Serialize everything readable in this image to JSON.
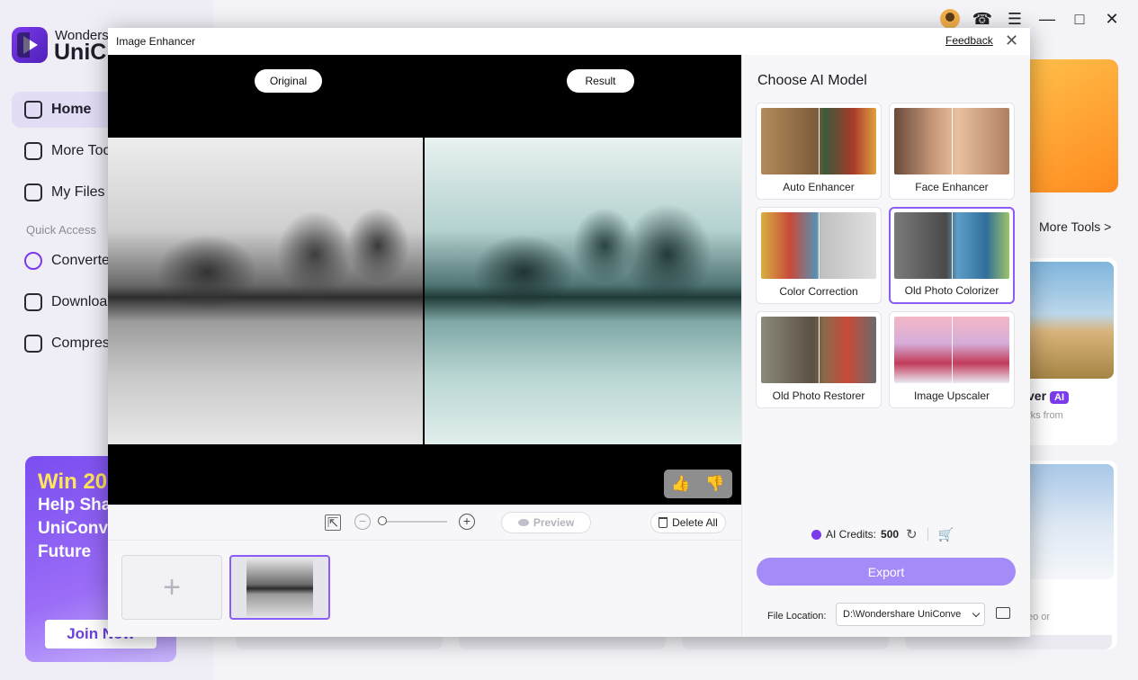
{
  "background": {
    "brand_line1": "Wonders",
    "brand_line2": "UniC",
    "nav": [
      "Home",
      "More Too",
      "My Files"
    ],
    "quick_access": "Quick Access",
    "quick_items": [
      "Converte",
      "Downloa",
      "Compres"
    ],
    "promo_line1": "Win 20",
    "promo_line2": "Help Sha",
    "promo_line3": "UniConv",
    "promo_line4": "Future",
    "promo_button": "Join Now",
    "more_tools": "More Tools  >",
    "ai_card_label": "ver",
    "ai_badge": "AI",
    "ai_card_sub": "rks from",
    "snow_card_sub": "eo or",
    "snow_card_dots": "...",
    "window_controls": [
      "avatar-icon",
      "headset-icon",
      "menu-icon",
      "minimize-icon",
      "maximize-icon",
      "close-icon"
    ]
  },
  "dialog": {
    "title": "Image Enhancer",
    "feedback": "Feedback",
    "close_icon": "close-icon",
    "preview": {
      "original_label": "Original",
      "result_label": "Result"
    },
    "toolbar": {
      "preview_label": "Preview",
      "delete_all_label": "Delete All"
    },
    "strip": {
      "add_glyph": "+"
    },
    "panel": {
      "title": "Choose AI Model",
      "models": [
        {
          "label": "Auto Enhancer",
          "selected": false
        },
        {
          "label": "Face Enhancer",
          "selected": false
        },
        {
          "label": "Color Correction",
          "selected": false
        },
        {
          "label": "Old Photo Colorizer",
          "selected": true
        },
        {
          "label": "Old Photo Restorer",
          "selected": false
        },
        {
          "label": "Image Upscaler",
          "selected": false
        }
      ],
      "credits_label": "AI Credits:",
      "credits_value": "500",
      "export_label": "Export",
      "file_location_label": "File Location:",
      "file_location_value": "D:\\Wondershare UniConve"
    }
  },
  "colors": {
    "accent": "#8b5cf6",
    "export_button": "#a58bf7",
    "brand_purple": "#7c3aed"
  }
}
